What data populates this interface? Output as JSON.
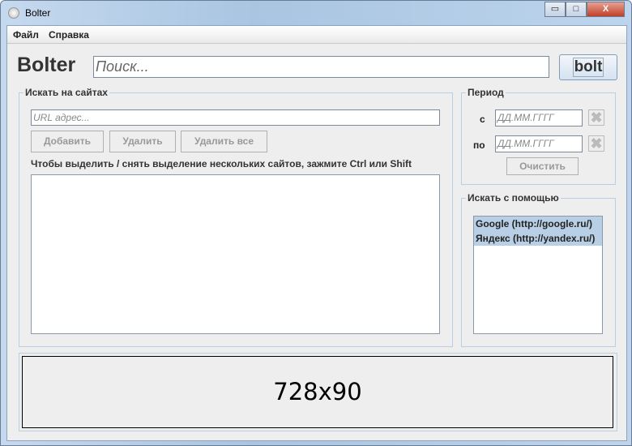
{
  "window": {
    "title": "Bolter",
    "minimize": "▭",
    "maximize": "□",
    "close": "X"
  },
  "menu": [
    "Файл",
    "Справка"
  ],
  "header": {
    "logo": "Bolter",
    "search_placeholder": "Поиск...",
    "bolt_label": "bolt"
  },
  "sites": {
    "group_label": "Искать на сайтах",
    "url_placeholder": "URL адрес...",
    "add_label": "Добавить",
    "delete_label": "Удалить",
    "delete_all_label": "Удалить все",
    "hint": "Чтобы выделить / снять выделение нескольких сайтов, зажмите Ctrl или Shift"
  },
  "period": {
    "group_label": "Период",
    "from_label": "с",
    "to_label": "по",
    "date_placeholder": "ДД.ММ.ГГГГ",
    "clear_icon": "✖",
    "clear_label": "Очистить"
  },
  "engines": {
    "group_label": "Искать с помощью",
    "items": [
      "Google (http://google.ru/)",
      "Яндекс (http://yandex.ru/)"
    ]
  },
  "banner": {
    "text": "728x90"
  }
}
